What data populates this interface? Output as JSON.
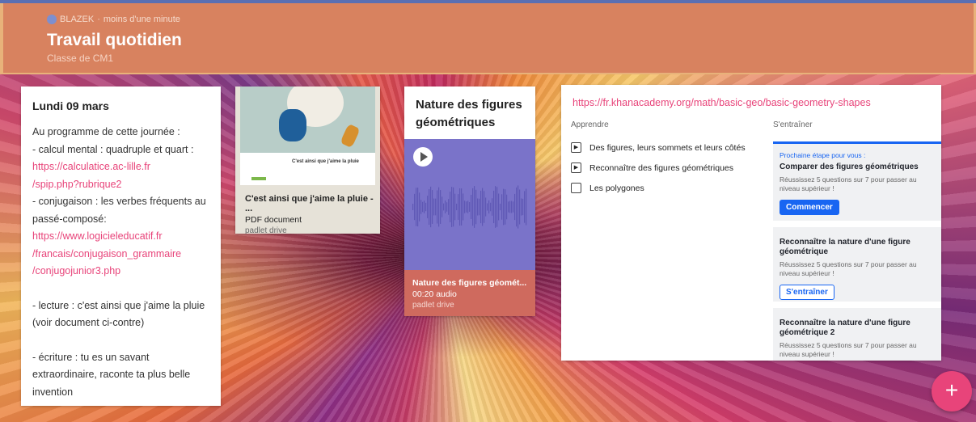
{
  "header": {
    "author": "BLAZEK",
    "time": "moins d'une minute",
    "title": "Travail quotidien",
    "subtitle": "Classe de CM1"
  },
  "note_card": {
    "title": "Lundi 09 mars",
    "lines": [
      {
        "text": "Au programme de cette journée :",
        "link": false
      },
      {
        "text": "- calcul mental : quadruple et quart :",
        "link": false
      },
      {
        "text": "https://calculatice.ac-lille.fr",
        "link": true
      },
      {
        "text": "/spip.php?rubrique2",
        "link": true
      },
      {
        "text": "- conjugaison : les verbes fréquents au",
        "link": false
      },
      {
        "text": "passé-composé:",
        "link": false
      },
      {
        "text": "https://www.logicieleducatif.fr",
        "link": true
      },
      {
        "text": "/francais/conjugaison_grammaire",
        "link": true
      },
      {
        "text": "/conjugojunior3.php",
        "link": true
      },
      {
        "text": "",
        "link": false
      },
      {
        "text": "- lecture : c'est ainsi que j'aime la pluie",
        "link": false
      },
      {
        "text": "(voir document ci-contre)",
        "link": false
      },
      {
        "text": "",
        "link": false
      },
      {
        "text": "- écriture : tu es un savant",
        "link": false
      },
      {
        "text": "extraordinaire, raconte ta plus belle",
        "link": false
      },
      {
        "text": "invention",
        "link": false
      }
    ]
  },
  "pdf_card": {
    "thumb_title": "C'est ainsi que j'aime la pluie",
    "title": "C'est ainsi que j'aime la pluie - ...",
    "type": "PDF document",
    "source": "padlet drive"
  },
  "audio_card": {
    "heading": "Nature des figures géométriques",
    "title": "Nature des figures géomét...",
    "meta": "00:20 audio",
    "source": "padlet drive",
    "media_color": "#7a73c9"
  },
  "khan_card": {
    "url": "https://fr.khanacademy.org/math/basic-geo/basic-geometry-shapes",
    "learn_heading": "Apprendre",
    "practice_heading": "S'entraîner",
    "learn_items": [
      {
        "icon": "play-icon",
        "label": "Des figures, leurs sommets et leurs côtés"
      },
      {
        "icon": "play-icon",
        "label": "Reconnaître des figures géométriques"
      },
      {
        "icon": "document-icon",
        "label": "Les polygones"
      }
    ],
    "panels": [
      {
        "kicker": "Prochaine étape pour vous :",
        "title": "Comparer des figures géométriques",
        "desc": "Réussissez 5 questions sur 7 pour passer au niveau supérieur !",
        "button": "Commencer",
        "solid": true
      },
      {
        "kicker": "",
        "title": "Reconnaître la nature d'une figure géométrique",
        "desc": "Réussissez 5 questions sur 7 pour passer au niveau supérieur !",
        "button": "S'entraîner",
        "solid": false
      },
      {
        "kicker": "",
        "title": "Reconnaître la nature d'une figure géométrique 2",
        "desc": "Réussissez 5 questions sur 7 pour passer au niveau supérieur !",
        "button": "",
        "solid": false
      }
    ]
  },
  "fab": {
    "label": "+"
  },
  "colors": {
    "accent": "#e8447a",
    "header": "#d8825f",
    "khan_blue": "#1865f2"
  }
}
